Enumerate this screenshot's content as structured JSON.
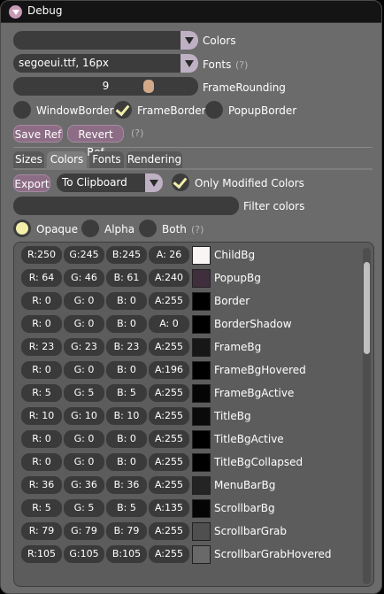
{
  "window": {
    "title": "Debug"
  },
  "colors_combo": {
    "value": "",
    "label": "Colors"
  },
  "fonts_combo": {
    "value": "segoeui.ttf, 16px",
    "label": "Fonts",
    "help": "(?)"
  },
  "frame_rounding": {
    "value": "9",
    "label": "FrameRounding",
    "fraction": 0.72
  },
  "borders": [
    {
      "label": "WindowBorder",
      "checked": false
    },
    {
      "label": "FrameBorder",
      "checked": true
    },
    {
      "label": "PopupBorder",
      "checked": false
    }
  ],
  "ref": {
    "save": "Save Ref",
    "revert": "Revert Ref",
    "help": "(?)"
  },
  "tabs": [
    {
      "label": "Sizes",
      "active": false
    },
    {
      "label": "Colors",
      "active": true
    },
    {
      "label": "Fonts",
      "active": false
    },
    {
      "label": "Rendering",
      "active": false
    }
  ],
  "export": {
    "button": "Export",
    "target": "To Clipboard",
    "only_modified": "Only Modified Colors"
  },
  "filter": {
    "value": "",
    "label": "Filter colors"
  },
  "alpha_mode": {
    "options": [
      "Opaque",
      "Alpha",
      "Both"
    ],
    "selected": "Opaque",
    "help": "(?)"
  },
  "colors": [
    {
      "r": "R:250",
      "g": "G:245",
      "b": "B:245",
      "a": "A: 26",
      "name": "ChildBg",
      "hex": "#faf5f5"
    },
    {
      "r": "R: 64",
      "g": "G: 46",
      "b": "B: 61",
      "a": "A:240",
      "name": "PopupBg",
      "hex": "#402e3d"
    },
    {
      "r": "R:  0",
      "g": "G:  0",
      "b": "B:  0",
      "a": "A:255",
      "name": "Border",
      "hex": "#000000"
    },
    {
      "r": "R:  0",
      "g": "G:  0",
      "b": "B:  0",
      "a": "A:  0",
      "name": "BorderShadow",
      "hex": "#000000"
    },
    {
      "r": "R: 23",
      "g": "G: 23",
      "b": "B: 23",
      "a": "A:255",
      "name": "FrameBg",
      "hex": "#171717"
    },
    {
      "r": "R:  0",
      "g": "G:  0",
      "b": "B:  0",
      "a": "A:196",
      "name": "FrameBgHovered",
      "hex": "#000000"
    },
    {
      "r": "R:  5",
      "g": "G:  5",
      "b": "B:  5",
      "a": "A:255",
      "name": "FrameBgActive",
      "hex": "#050505"
    },
    {
      "r": "R: 10",
      "g": "G: 10",
      "b": "B: 10",
      "a": "A:255",
      "name": "TitleBg",
      "hex": "#0a0a0a"
    },
    {
      "r": "R:  0",
      "g": "G:  0",
      "b": "B:  0",
      "a": "A:255",
      "name": "TitleBgActive",
      "hex": "#000000"
    },
    {
      "r": "R:  0",
      "g": "G:  0",
      "b": "B:  0",
      "a": "A:255",
      "name": "TitleBgCollapsed",
      "hex": "#000000"
    },
    {
      "r": "R: 36",
      "g": "G: 36",
      "b": "B: 36",
      "a": "A:255",
      "name": "MenuBarBg",
      "hex": "#242424"
    },
    {
      "r": "R:  5",
      "g": "G:  5",
      "b": "B:  5",
      "a": "A:135",
      "name": "ScrollbarBg",
      "hex": "#050505"
    },
    {
      "r": "R: 79",
      "g": "G: 79",
      "b": "B: 79",
      "a": "A:255",
      "name": "ScrollbarGrab",
      "hex": "#4f4f4f"
    },
    {
      "r": "R:105",
      "g": "G:105",
      "b": "B:105",
      "a": "A:255",
      "name": "ScrollbarGrabHovered",
      "hex": "#696969"
    }
  ]
}
